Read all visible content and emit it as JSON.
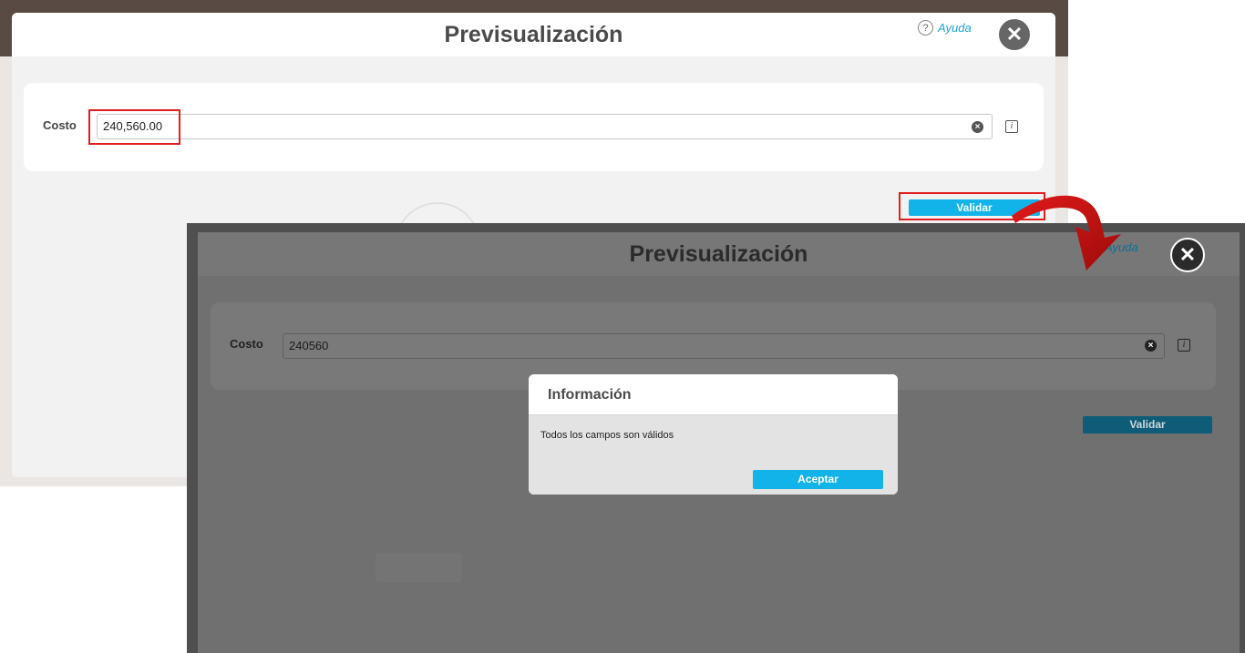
{
  "first_screen": {
    "modal": {
      "title": "Previsualización",
      "help_label": "Ayuda",
      "field": {
        "label": "Costo",
        "value": "240,560.00"
      },
      "validate_label": "Validar"
    }
  },
  "second_screen": {
    "modal": {
      "title": "Previsualización",
      "help_label": "Ayuda",
      "field": {
        "label": "Costo",
        "value": "240560"
      },
      "validate_label": "Validar"
    },
    "dialog": {
      "title": "Información",
      "message": "Todos los campos son válidos",
      "accept_label": "Aceptar"
    }
  },
  "colors": {
    "accent": "#12b3e8",
    "highlight": "#e02020",
    "arrow": "#c40d0d"
  }
}
